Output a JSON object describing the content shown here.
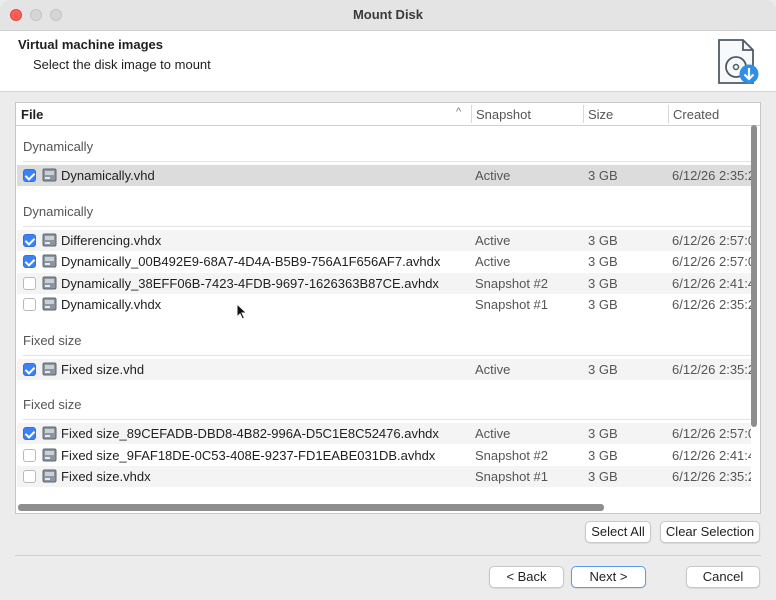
{
  "window": {
    "title": "Mount Disk"
  },
  "header": {
    "title": "Virtual machine images",
    "subtitle": "Select the disk image to mount",
    "icon": "disk-download-icon"
  },
  "table": {
    "columns": {
      "file": "File",
      "snapshot": "Snapshot",
      "size": "Size",
      "created": "Created"
    },
    "groups": [
      {
        "label": "Dynamically",
        "rows": [
          {
            "checked": true,
            "file": "Dynamically.vhd",
            "snapshot": "Active",
            "size": "3 GB",
            "created": "6/12/26 2:35:2"
          }
        ]
      },
      {
        "label": "Dynamically",
        "rows": [
          {
            "checked": true,
            "file": "Differencing.vhdx",
            "snapshot": "Active",
            "size": "3 GB",
            "created": "6/12/26 2:57:0"
          },
          {
            "checked": true,
            "file": "Dynamically_00B492E9-68A7-4D4A-B5B9-756A1F656AF7.avhdx",
            "snapshot": "Active",
            "size": "3 GB",
            "created": "6/12/26 2:57:0"
          },
          {
            "checked": false,
            "file": "Dynamically_38EFF06B-7423-4FDB-9697-1626363B87CE.avhdx",
            "snapshot": "Snapshot #2",
            "size": "3 GB",
            "created": "6/12/26 2:41:4"
          },
          {
            "checked": false,
            "file": "Dynamically.vhdx",
            "snapshot": "Snapshot #1",
            "size": "3 GB",
            "created": "6/12/26 2:35:2"
          }
        ]
      },
      {
        "label": "Fixed size",
        "rows": [
          {
            "checked": true,
            "file": "Fixed size.vhd",
            "snapshot": "Active",
            "size": "3 GB",
            "created": "6/12/26 2:35:2"
          }
        ]
      },
      {
        "label": "Fixed size",
        "rows": [
          {
            "checked": true,
            "file": "Fixed size_89CEFADB-DBD8-4B82-996A-D5C1E8C52476.avhdx",
            "snapshot": "Active",
            "size": "3 GB",
            "created": "6/12/26 2:57:0"
          },
          {
            "checked": false,
            "file": "Fixed size_9FAF18DE-0C53-408E-9237-FD1EABE031DB.avhdx",
            "snapshot": "Snapshot #2",
            "size": "3 GB",
            "created": "6/12/26 2:41:4"
          },
          {
            "checked": false,
            "file": "Fixed size.vhdx",
            "snapshot": "Snapshot #1",
            "size": "3 GB",
            "created": "6/12/26 2:35:2"
          }
        ]
      }
    ]
  },
  "buttons": {
    "select_all": "Select All",
    "clear_selection": "Clear Selection",
    "back": "< Back",
    "next": "Next >",
    "cancel": "Cancel"
  },
  "colors": {
    "accent": "#3b82f6",
    "close": "#ff5f57"
  }
}
